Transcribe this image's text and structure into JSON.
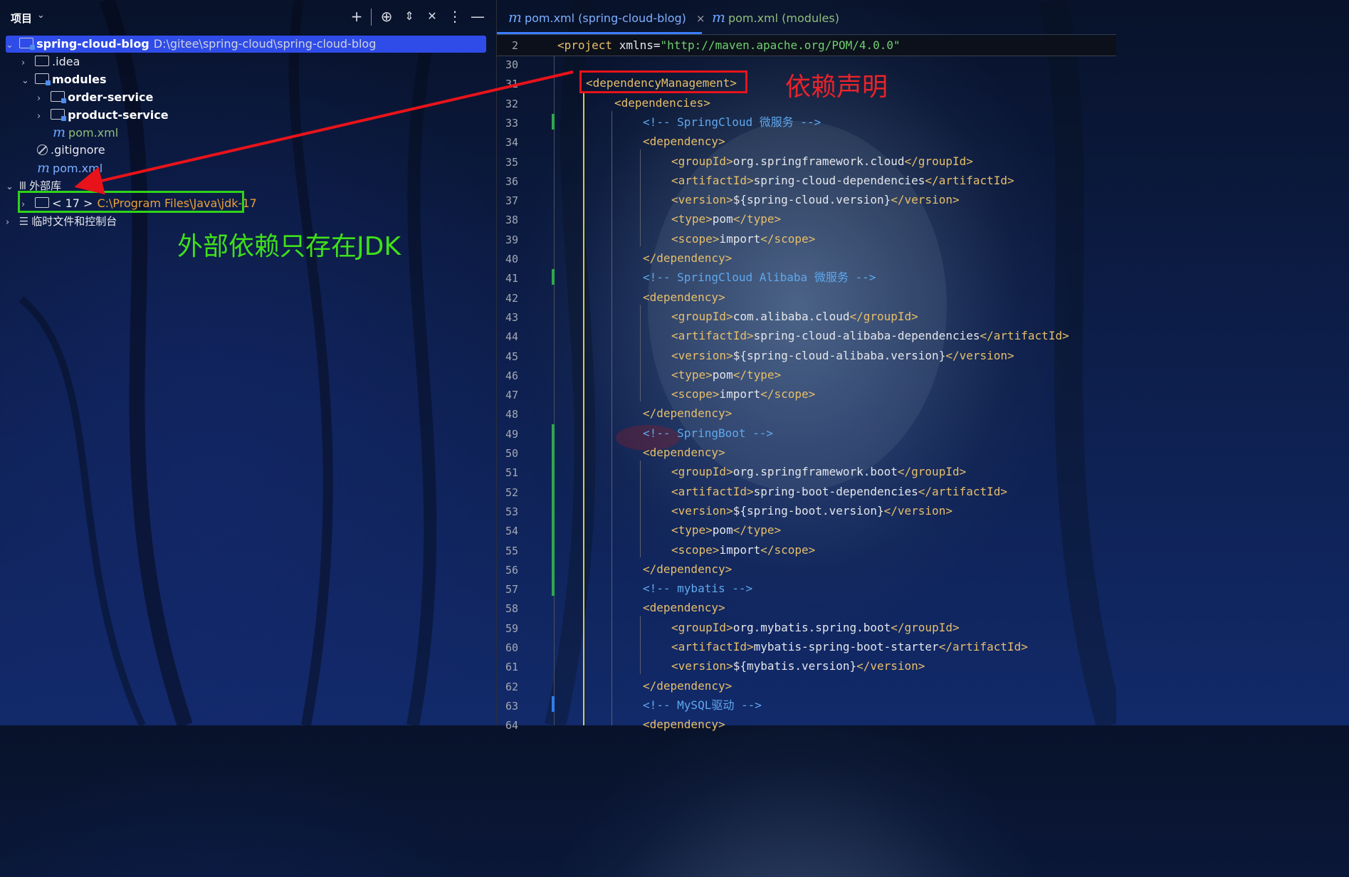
{
  "project_panel": {
    "title": "项目",
    "tree": {
      "root_name": "spring-cloud-blog",
      "root_path": "D:\\gitee\\spring-cloud\\spring-cloud-blog",
      "idea": ".idea",
      "modules": "modules",
      "order_service": "order-service",
      "product_service": "product-service",
      "modules_pom": "pom.xml",
      "gitignore": ".gitignore",
      "root_pom": "pom.xml",
      "external_libs": "外部库",
      "jdk_label": "< 17 >",
      "jdk_path": "C:\\Program Files\\Java\\jdk-17",
      "scratches": "临时文件和控制台"
    }
  },
  "annotations": {
    "green_note": "外部依赖只存在JDK",
    "red_note": "依赖声明"
  },
  "editor": {
    "tabs": [
      {
        "label": "pom.xml (spring-cloud-blog)",
        "active": true
      },
      {
        "label": "pom.xml (modules)",
        "active": false
      }
    ],
    "sticky": {
      "line": "2",
      "tag": "<project ",
      "attr": "xmlns=",
      "value": "\"http://maven.apache.org/POM/4.0.0\""
    },
    "lines": [
      {
        "n": "30",
        "parts": []
      },
      {
        "n": "31",
        "parts": [
          {
            "c": "tg",
            "t": "<dependencyManagement>"
          }
        ]
      },
      {
        "n": "32",
        "parts": [
          {
            "c": "tg",
            "t": "<dependencies>"
          }
        ]
      },
      {
        "n": "33",
        "parts": [
          {
            "c": "ct",
            "t": "<!-- SpringCloud 微服务 -->"
          }
        ]
      },
      {
        "n": "34",
        "parts": [
          {
            "c": "tg",
            "t": "<dependency>"
          }
        ]
      },
      {
        "n": "35",
        "parts": [
          {
            "c": "tg",
            "t": "<groupId>"
          },
          {
            "c": "tx",
            "t": "org.springframework.cloud"
          },
          {
            "c": "tg",
            "t": "</groupId>"
          }
        ]
      },
      {
        "n": "36",
        "parts": [
          {
            "c": "tg",
            "t": "<artifactId>"
          },
          {
            "c": "tx",
            "t": "spring-cloud-dependencies"
          },
          {
            "c": "tg",
            "t": "</artifactId>"
          }
        ]
      },
      {
        "n": "37",
        "parts": [
          {
            "c": "tg",
            "t": "<version>"
          },
          {
            "c": "tx",
            "t": "${spring-cloud.version}"
          },
          {
            "c": "tg",
            "t": "</version>"
          }
        ]
      },
      {
        "n": "38",
        "parts": [
          {
            "c": "tg",
            "t": "<type>"
          },
          {
            "c": "tx",
            "t": "pom"
          },
          {
            "c": "tg",
            "t": "</type>"
          }
        ]
      },
      {
        "n": "39",
        "parts": [
          {
            "c": "tg",
            "t": "<scope>"
          },
          {
            "c": "tx",
            "t": "import"
          },
          {
            "c": "tg",
            "t": "</scope>"
          }
        ]
      },
      {
        "n": "40",
        "parts": [
          {
            "c": "tg",
            "t": "</dependency>"
          }
        ]
      },
      {
        "n": "41",
        "parts": [
          {
            "c": "ct",
            "t": "<!-- SpringCloud Alibaba 微服务 -->"
          }
        ]
      },
      {
        "n": "42",
        "parts": [
          {
            "c": "tg",
            "t": "<dependency>"
          }
        ]
      },
      {
        "n": "43",
        "parts": [
          {
            "c": "tg",
            "t": "<groupId>"
          },
          {
            "c": "tx",
            "t": "com.alibaba.cloud"
          },
          {
            "c": "tg",
            "t": "</groupId>"
          }
        ]
      },
      {
        "n": "44",
        "parts": [
          {
            "c": "tg",
            "t": "<artifactId>"
          },
          {
            "c": "tx",
            "t": "spring-cloud-alibaba-dependencies"
          },
          {
            "c": "tg",
            "t": "</artifactId>"
          }
        ]
      },
      {
        "n": "45",
        "parts": [
          {
            "c": "tg",
            "t": "<version>"
          },
          {
            "c": "tx",
            "t": "${spring-cloud-alibaba.version}"
          },
          {
            "c": "tg",
            "t": "</version>"
          }
        ]
      },
      {
        "n": "46",
        "parts": [
          {
            "c": "tg",
            "t": "<type>"
          },
          {
            "c": "tx",
            "t": "pom"
          },
          {
            "c": "tg",
            "t": "</type>"
          }
        ]
      },
      {
        "n": "47",
        "parts": [
          {
            "c": "tg",
            "t": "<scope>"
          },
          {
            "c": "tx",
            "t": "import"
          },
          {
            "c": "tg",
            "t": "</scope>"
          }
        ]
      },
      {
        "n": "48",
        "parts": [
          {
            "c": "tg",
            "t": "</dependency>"
          }
        ]
      },
      {
        "n": "49",
        "parts": [
          {
            "c": "ct",
            "t": "<!-- SpringBoot -->"
          }
        ]
      },
      {
        "n": "50",
        "parts": [
          {
            "c": "tg",
            "t": "<dependency>"
          }
        ]
      },
      {
        "n": "51",
        "parts": [
          {
            "c": "tg",
            "t": "<groupId>"
          },
          {
            "c": "tx",
            "t": "org.springframework.boot"
          },
          {
            "c": "tg",
            "t": "</groupId>"
          }
        ]
      },
      {
        "n": "52",
        "parts": [
          {
            "c": "tg",
            "t": "<artifactId>"
          },
          {
            "c": "tx",
            "t": "spring-boot-dependencies"
          },
          {
            "c": "tg",
            "t": "</artifactId>"
          }
        ]
      },
      {
        "n": "53",
        "parts": [
          {
            "c": "tg",
            "t": "<version>"
          },
          {
            "c": "tx",
            "t": "${spring-boot.version}"
          },
          {
            "c": "tg",
            "t": "</version>"
          }
        ]
      },
      {
        "n": "54",
        "parts": [
          {
            "c": "tg",
            "t": "<type>"
          },
          {
            "c": "tx",
            "t": "pom"
          },
          {
            "c": "tg",
            "t": "</type>"
          }
        ]
      },
      {
        "n": "55",
        "parts": [
          {
            "c": "tg",
            "t": "<scope>"
          },
          {
            "c": "tx",
            "t": "import"
          },
          {
            "c": "tg",
            "t": "</scope>"
          }
        ]
      },
      {
        "n": "56",
        "parts": [
          {
            "c": "tg",
            "t": "</dependency>"
          }
        ]
      },
      {
        "n": "57",
        "parts": [
          {
            "c": "ct",
            "t": "<!-- mybatis -->"
          }
        ]
      },
      {
        "n": "58",
        "parts": [
          {
            "c": "tg",
            "t": "<dependency>"
          }
        ]
      },
      {
        "n": "59",
        "parts": [
          {
            "c": "tg",
            "t": "<groupId>"
          },
          {
            "c": "tx",
            "t": "org.mybatis.spring.boot"
          },
          {
            "c": "tg",
            "t": "</groupId>"
          }
        ]
      },
      {
        "n": "60",
        "parts": [
          {
            "c": "tg",
            "t": "<artifactId>"
          },
          {
            "c": "tx",
            "t": "mybatis-spring-boot-starter"
          },
          {
            "c": "tg",
            "t": "</artifactId>"
          }
        ]
      },
      {
        "n": "61",
        "parts": [
          {
            "c": "tg",
            "t": "<version>"
          },
          {
            "c": "tx",
            "t": "${mybatis.version}"
          },
          {
            "c": "tg",
            "t": "</version>"
          }
        ]
      },
      {
        "n": "62",
        "parts": [
          {
            "c": "tg",
            "t": "</dependency>"
          }
        ]
      },
      {
        "n": "63",
        "parts": [
          {
            "c": "ct",
            "t": "<!-- MySQL驱动 -->"
          }
        ]
      },
      {
        "n": "64",
        "parts": [
          {
            "c": "tg",
            "t": "<dependency>"
          }
        ]
      }
    ]
  },
  "colors": {
    "selection": "#2f4ce8",
    "tag": "#e8bf6a",
    "comment": "#5fa8ee",
    "annotation_red": "#e8131a",
    "annotation_green": "#2ed418"
  }
}
